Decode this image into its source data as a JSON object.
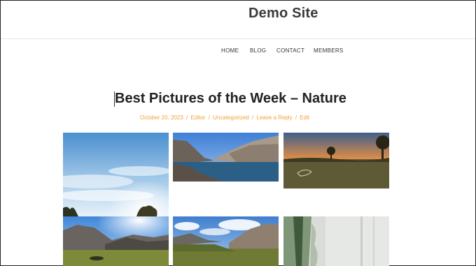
{
  "site": {
    "title": "Demo Site"
  },
  "nav": {
    "items": [
      "HOME",
      "BLOG",
      "CONTACT",
      "MEMBERS"
    ]
  },
  "post": {
    "title": "Best Pictures of the Week – Nature",
    "meta": {
      "date": "October 20, 2023",
      "author": "Editor",
      "category": "Uncategorized",
      "reply": "Leave a Reply",
      "edit": "Edit",
      "separator": "/"
    }
  },
  "gallery": {
    "photos": [
      {
        "subject": "sunny sky with clouds and trees"
      },
      {
        "subject": "mountain lake with rocky shore"
      },
      {
        "subject": "sunset over field with trees"
      },
      {
        "subject": "sun over mountain valley"
      },
      {
        "subject": "cloudy sky over mountain valley"
      },
      {
        "subject": "misty forest"
      }
    ]
  },
  "colors": {
    "accent": "#f0a135",
    "text": "#222222"
  }
}
